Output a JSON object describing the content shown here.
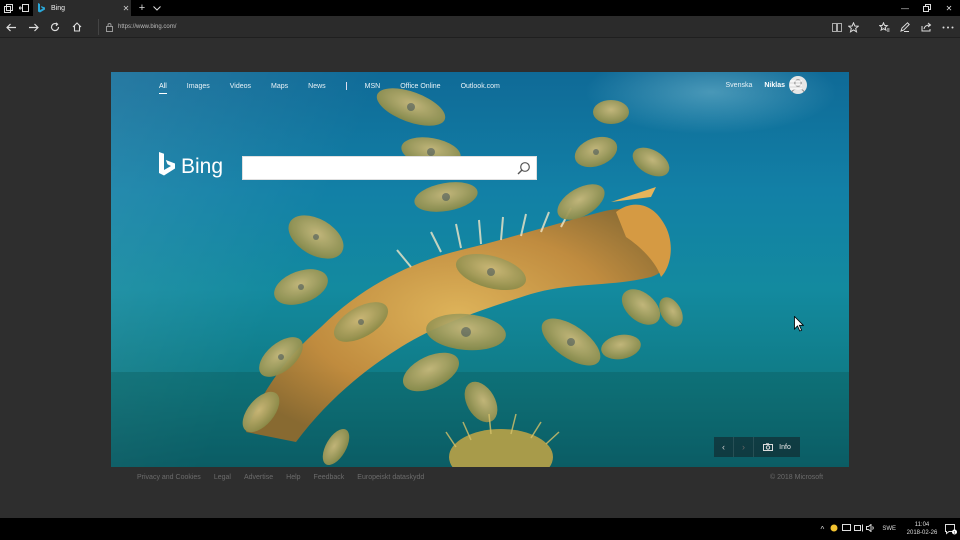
{
  "browser": {
    "tab_title": "Bing",
    "address": "https://www.bing.com/"
  },
  "bing": {
    "nav": [
      "All",
      "Images",
      "Videos",
      "Maps",
      "News",
      "MSN",
      "Office Online",
      "Outlook.com"
    ],
    "language": "Svenska",
    "user_name": "Niklas",
    "logo_text": "Bing",
    "search_value": "",
    "info_label": "Info",
    "prev_glyph": "‹",
    "next_glyph": "›"
  },
  "footer": {
    "links": [
      "Privacy and Cookies",
      "Legal",
      "Advertise",
      "Help",
      "Feedback",
      "Europeiskt dataskydd"
    ],
    "copyright": "© 2018 Microsoft"
  },
  "taskbar": {
    "language": "SWE",
    "time": "11:04",
    "date": "2018-02-26",
    "notification_count": "1"
  },
  "colors": {
    "accent": "#0f7a9e",
    "chrome_dark": "#2b2b2b",
    "titlebar": "#000000"
  }
}
